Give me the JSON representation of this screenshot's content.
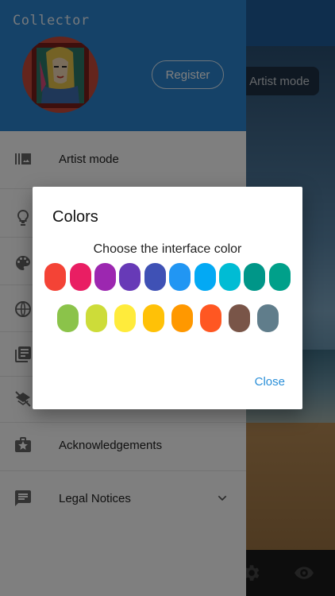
{
  "background": {
    "artist_mode_button": "Artist mode",
    "bottom_icons": [
      "settings-icon",
      "eye-icon"
    ]
  },
  "drawer": {
    "title": "Collector",
    "register_label": "Register",
    "accent_color": "#2a85d0",
    "items": [
      {
        "icon": "gallery-icon",
        "label": "Artist mode"
      },
      {
        "icon": "lightbulb-icon",
        "label": ""
      },
      {
        "icon": "palette-icon",
        "label": ""
      },
      {
        "icon": "globe-icon",
        "label": ""
      },
      {
        "icon": "library-icon",
        "label": ""
      },
      {
        "icon": "layers-off-icon",
        "label": ""
      },
      {
        "icon": "award-icon",
        "label": "Acknowledgements"
      },
      {
        "icon": "message-icon",
        "label": "Legal Notices"
      }
    ]
  },
  "dialog": {
    "title": "Colors",
    "subtitle": "Choose the interface color",
    "close_label": "Close",
    "colors_row1": [
      "#f44336",
      "#e91e63",
      "#9c27b0",
      "#673ab7",
      "#3f51b5",
      "#2196f3",
      "#03a9f4",
      "#00bcd4",
      "#009688",
      "#00a08a"
    ],
    "colors_row2": [
      "#8bc34a",
      "#cddc39",
      "#ffeb3b",
      "#ffc107",
      "#ff9800",
      "#ff5722",
      "#795548",
      "#607d8b"
    ]
  }
}
